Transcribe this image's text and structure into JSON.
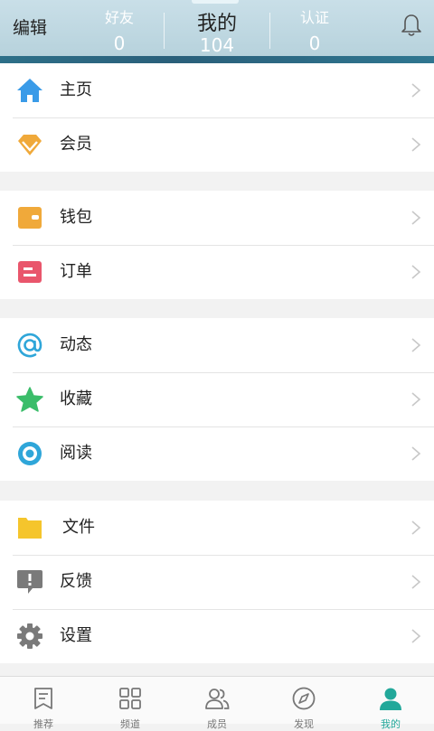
{
  "header": {
    "edit_label": "编辑",
    "stats": [
      {
        "label": "好友",
        "count": "0"
      },
      {
        "label": "我的",
        "count": "104"
      },
      {
        "label": "认证",
        "count": "0"
      }
    ]
  },
  "menu_groups": [
    {
      "items": [
        {
          "label": "主页",
          "icon": "home-icon"
        },
        {
          "label": "会员",
          "icon": "diamond-icon"
        }
      ]
    },
    {
      "items": [
        {
          "label": "钱包",
          "icon": "wallet-icon"
        },
        {
          "label": "订单",
          "icon": "order-icon"
        }
      ]
    },
    {
      "items": [
        {
          "label": "动态",
          "icon": "at-sign-icon"
        },
        {
          "label": "收藏",
          "icon": "star-icon"
        },
        {
          "label": "阅读",
          "icon": "eye-icon"
        }
      ]
    },
    {
      "items": [
        {
          "label": "文件",
          "icon": "folder-icon"
        },
        {
          "label": "反馈",
          "icon": "feedback-icon"
        },
        {
          "label": "设置",
          "icon": "gear-icon"
        }
      ]
    }
  ],
  "bottom_nav": [
    {
      "label": "推荐",
      "icon": "recommend-icon"
    },
    {
      "label": "频道",
      "icon": "grid-icon"
    },
    {
      "label": "成员",
      "icon": "members-icon"
    },
    {
      "label": "发现",
      "icon": "compass-icon"
    },
    {
      "label": "我的",
      "icon": "profile-icon"
    }
  ],
  "colors": {
    "accent": "#22a89a",
    "header_bg": "#c2dae3",
    "header_strip": "#2a6580"
  }
}
